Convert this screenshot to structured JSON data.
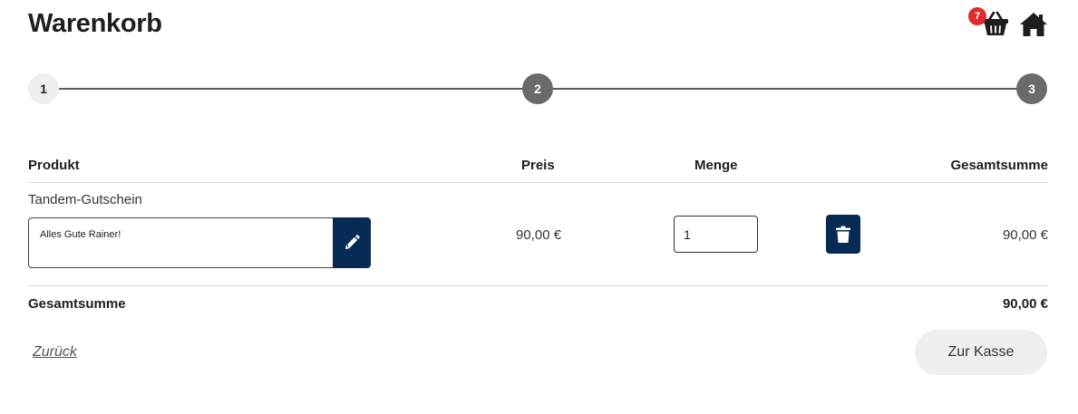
{
  "header": {
    "title": "Warenkorb",
    "cart_count": "7",
    "icons": {
      "cart": "shopping-basket-icon",
      "home": "home-icon"
    }
  },
  "stepper": {
    "steps": [
      {
        "label": "1",
        "state": "active"
      },
      {
        "label": "2",
        "state": "inactive"
      },
      {
        "label": "3",
        "state": "inactive"
      }
    ]
  },
  "table": {
    "columns": [
      "Produkt",
      "Preis",
      "Menge",
      "Gesamtsumme"
    ],
    "rows": [
      {
        "product": "Tandem-Gutschein",
        "note": "Alles Gute Rainer!",
        "price": "90,00 €",
        "quantity": "1",
        "total": "90,00 €"
      }
    ]
  },
  "summary": {
    "label": "Gesamtsumme",
    "value": "90,00 €"
  },
  "actions": {
    "back_label": "Zurück",
    "checkout_label": "Zur Kasse"
  },
  "colors": {
    "primary": "#072a55",
    "badge": "#e02b2b",
    "step_active_bg": "#efeff2",
    "step_inactive_bg": "#6a6a6a"
  }
}
